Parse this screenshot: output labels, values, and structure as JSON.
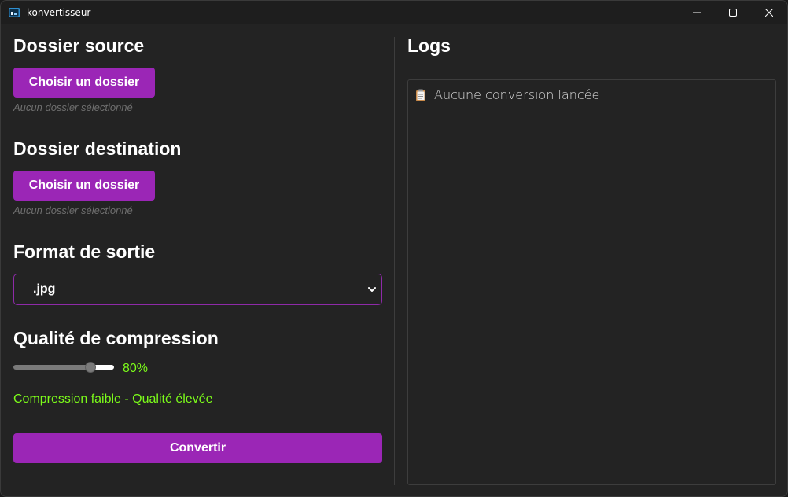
{
  "window": {
    "title": "konvertisseur"
  },
  "source": {
    "heading": "Dossier source",
    "button_label": "Choisir un dossier",
    "status": "Aucun dossier sélectionné"
  },
  "destination": {
    "heading": "Dossier destination",
    "button_label": "Choisir un dossier",
    "status": "Aucun dossier sélectionné"
  },
  "format": {
    "heading": "Format de sortie",
    "selected": ".jpg"
  },
  "compression": {
    "heading": "Qualité de compression",
    "value_percent": 80,
    "value_label": "80%",
    "description": "Compression faible - Qualité élevée"
  },
  "convert": {
    "label": "Convertir"
  },
  "logs": {
    "heading": "Logs",
    "entries": [
      {
        "icon": "clipboard-icon",
        "text": "Aucune conversion lancée"
      }
    ]
  },
  "colors": {
    "accent": "#9b26b6",
    "success_text": "#7cfc1a",
    "background": "#232323",
    "titlebar": "#1e1e1e"
  }
}
